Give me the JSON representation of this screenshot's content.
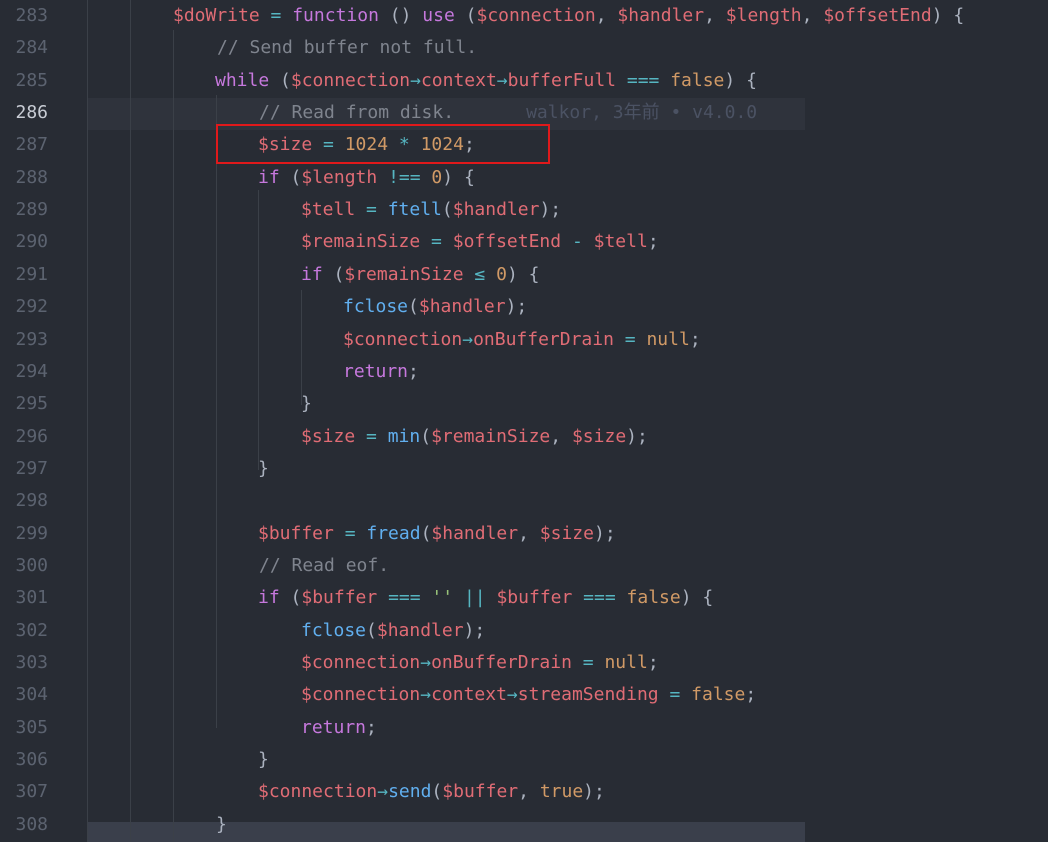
{
  "editor": {
    "current_line": "286",
    "blame": "walkor, 3年前 • v4.0.0",
    "lines": [
      {
        "num": "283",
        "tokens": [
          [
            "v",
            "$doWrite"
          ],
          [
            "o",
            " = "
          ],
          [
            "k",
            "function"
          ],
          [
            "p",
            " () "
          ],
          [
            "k",
            "use"
          ],
          [
            "p",
            " ("
          ],
          [
            "v",
            "$connection"
          ],
          [
            "p",
            ", "
          ],
          [
            "v",
            "$handler"
          ],
          [
            "p",
            ", "
          ],
          [
            "v",
            "$length"
          ],
          [
            "p",
            ", "
          ],
          [
            "v",
            "$offsetEnd"
          ],
          [
            "p",
            ") {"
          ]
        ]
      },
      {
        "num": "284",
        "tokens": [
          [
            "c",
            "// Send buffer not full."
          ]
        ]
      },
      {
        "num": "285",
        "tokens": [
          [
            "k",
            "while"
          ],
          [
            "p",
            " ("
          ],
          [
            "v",
            "$connection"
          ],
          [
            "o",
            "→"
          ],
          [
            "pr",
            "context"
          ],
          [
            "o",
            "→"
          ],
          [
            "pr",
            "bufferFull"
          ],
          [
            "o",
            " === "
          ],
          [
            "n",
            "false"
          ],
          [
            "p",
            ") {"
          ]
        ]
      },
      {
        "num": "286",
        "tokens": [
          [
            "c",
            "// Read from disk."
          ]
        ]
      },
      {
        "num": "287",
        "tokens": [
          [
            "v",
            "$size"
          ],
          [
            "o",
            " = "
          ],
          [
            "n",
            "1024"
          ],
          [
            "o",
            " * "
          ],
          [
            "n",
            "1024"
          ],
          [
            "p",
            ";"
          ]
        ]
      },
      {
        "num": "288",
        "tokens": [
          [
            "k",
            "if"
          ],
          [
            "p",
            " ("
          ],
          [
            "v",
            "$length"
          ],
          [
            "o",
            " !== "
          ],
          [
            "n",
            "0"
          ],
          [
            "p",
            ") {"
          ]
        ]
      },
      {
        "num": "289",
        "tokens": [
          [
            "v",
            "$tell"
          ],
          [
            "o",
            " = "
          ],
          [
            "f",
            "ftell"
          ],
          [
            "p",
            "("
          ],
          [
            "v",
            "$handler"
          ],
          [
            "p",
            ");"
          ]
        ]
      },
      {
        "num": "290",
        "tokens": [
          [
            "v",
            "$remainSize"
          ],
          [
            "o",
            " = "
          ],
          [
            "v",
            "$offsetEnd"
          ],
          [
            "o",
            " - "
          ],
          [
            "v",
            "$tell"
          ],
          [
            "p",
            ";"
          ]
        ]
      },
      {
        "num": "291",
        "tokens": [
          [
            "k",
            "if"
          ],
          [
            "p",
            " ("
          ],
          [
            "v",
            "$remainSize"
          ],
          [
            "o",
            " ≤ "
          ],
          [
            "n",
            "0"
          ],
          [
            "p",
            ") {"
          ]
        ]
      },
      {
        "num": "292",
        "tokens": [
          [
            "f",
            "fclose"
          ],
          [
            "p",
            "("
          ],
          [
            "v",
            "$handler"
          ],
          [
            "p",
            ");"
          ]
        ]
      },
      {
        "num": "293",
        "tokens": [
          [
            "v",
            "$connection"
          ],
          [
            "o",
            "→"
          ],
          [
            "pr",
            "onBufferDrain"
          ],
          [
            "o",
            " = "
          ],
          [
            "n",
            "null"
          ],
          [
            "p",
            ";"
          ]
        ]
      },
      {
        "num": "294",
        "tokens": [
          [
            "k",
            "return"
          ],
          [
            "p",
            ";"
          ]
        ]
      },
      {
        "num": "295",
        "tokens": [
          [
            "p",
            "}"
          ]
        ]
      },
      {
        "num": "296",
        "tokens": [
          [
            "v",
            "$size"
          ],
          [
            "o",
            " = "
          ],
          [
            "f",
            "min"
          ],
          [
            "p",
            "("
          ],
          [
            "v",
            "$remainSize"
          ],
          [
            "p",
            ", "
          ],
          [
            "v",
            "$size"
          ],
          [
            "p",
            ");"
          ]
        ]
      },
      {
        "num": "297",
        "tokens": [
          [
            "p",
            "}"
          ]
        ]
      },
      {
        "num": "298",
        "tokens": []
      },
      {
        "num": "299",
        "tokens": [
          [
            "v",
            "$buffer"
          ],
          [
            "o",
            " = "
          ],
          [
            "f",
            "fread"
          ],
          [
            "p",
            "("
          ],
          [
            "v",
            "$handler"
          ],
          [
            "p",
            ", "
          ],
          [
            "v",
            "$size"
          ],
          [
            "p",
            ");"
          ]
        ]
      },
      {
        "num": "300",
        "tokens": [
          [
            "c",
            "// Read eof."
          ]
        ]
      },
      {
        "num": "301",
        "tokens": [
          [
            "k",
            "if"
          ],
          [
            "p",
            " ("
          ],
          [
            "v",
            "$buffer"
          ],
          [
            "o",
            " === "
          ],
          [
            "s",
            "''"
          ],
          [
            "o",
            " || "
          ],
          [
            "v",
            "$buffer"
          ],
          [
            "o",
            " === "
          ],
          [
            "n",
            "false"
          ],
          [
            "p",
            ") {"
          ]
        ]
      },
      {
        "num": "302",
        "tokens": [
          [
            "f",
            "fclose"
          ],
          [
            "p",
            "("
          ],
          [
            "v",
            "$handler"
          ],
          [
            "p",
            ");"
          ]
        ]
      },
      {
        "num": "303",
        "tokens": [
          [
            "v",
            "$connection"
          ],
          [
            "o",
            "→"
          ],
          [
            "pr",
            "onBufferDrain"
          ],
          [
            "o",
            " = "
          ],
          [
            "n",
            "null"
          ],
          [
            "p",
            ";"
          ]
        ]
      },
      {
        "num": "304",
        "tokens": [
          [
            "v",
            "$connection"
          ],
          [
            "o",
            "→"
          ],
          [
            "pr",
            "context"
          ],
          [
            "o",
            "→"
          ],
          [
            "pr",
            "streamSending"
          ],
          [
            "o",
            " = "
          ],
          [
            "n",
            "false"
          ],
          [
            "p",
            ";"
          ]
        ]
      },
      {
        "num": "305",
        "tokens": [
          [
            "k",
            "return"
          ],
          [
            "p",
            ";"
          ]
        ]
      },
      {
        "num": "306",
        "tokens": [
          [
            "p",
            "}"
          ]
        ]
      },
      {
        "num": "307",
        "tokens": [
          [
            "v",
            "$connection"
          ],
          [
            "o",
            "→"
          ],
          [
            "f",
            "send"
          ],
          [
            "p",
            "("
          ],
          [
            "v",
            "$buffer"
          ],
          [
            "p",
            ", "
          ],
          [
            "n",
            "true"
          ],
          [
            "p",
            ");"
          ]
        ]
      },
      {
        "num": "308",
        "tokens": [
          [
            "p",
            "}"
          ]
        ]
      }
    ]
  },
  "colors": {
    "background": "#282c34",
    "highlight_box": "#e0191b"
  }
}
